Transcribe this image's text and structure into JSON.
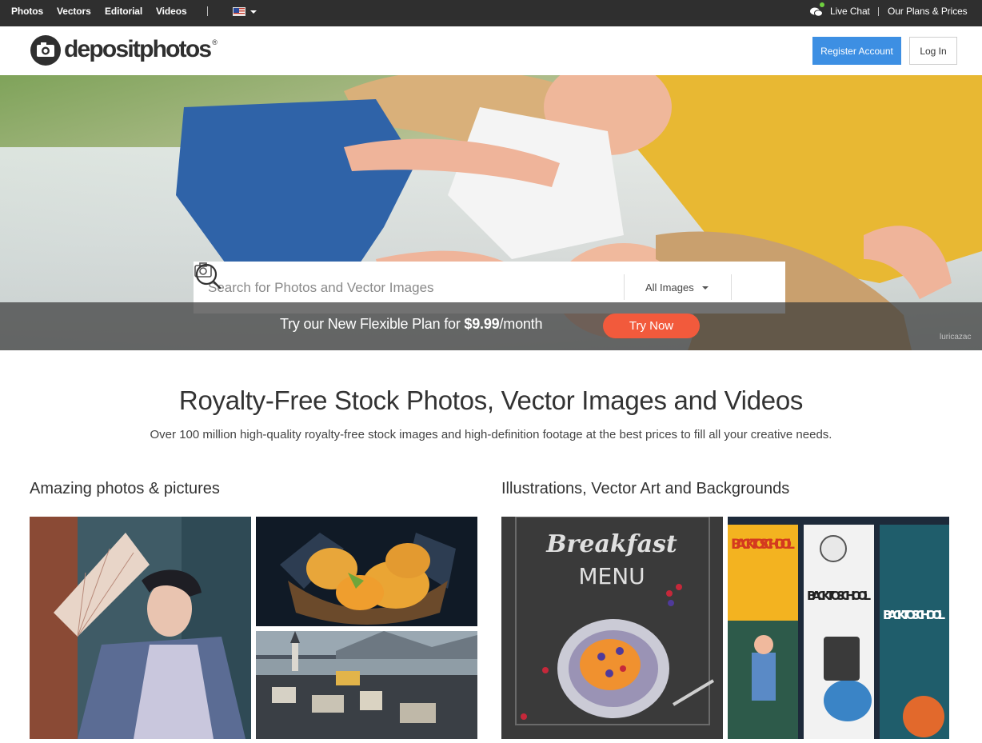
{
  "topbar": {
    "nav": [
      "Photos",
      "Vectors",
      "Editorial",
      "Videos"
    ],
    "live_chat": "Live Chat",
    "plans": "Our Plans & Prices"
  },
  "header": {
    "logo_text": "depositphotos",
    "logo_reg": "®",
    "register_label": "Register Account",
    "login_label": "Log In"
  },
  "hero": {
    "search_placeholder": "Search for Photos and Vector Images",
    "image_type": "All Images",
    "promo_prefix": "Try our New Flexible Plan for ",
    "promo_price": "$9.99",
    "promo_suffix": "/month",
    "cta_label": "Try Now",
    "photo_credit": "luricazac"
  },
  "intro": {
    "title": "Royalty-Free Stock Photos, Vector Images and Videos",
    "subtitle": "Over 100 million high-quality royalty-free stock images and high-definition footage at the best prices to fill all your creative needs."
  },
  "sections": {
    "photos_title": "Amazing photos & pictures",
    "vectors_title": "Illustrations, Vector Art and Backgrounds"
  },
  "tiles": {
    "breakfast_line1": "Breakfast",
    "breakfast_line2": "MENU",
    "back_to_school_1": "BACK TO SCHOOL",
    "back_to_school_2": "BACK TO SCHOOL",
    "back_to_school_3": "BACK TO SCHOOL"
  },
  "colors": {
    "topbar": "#2f2f2f",
    "register_blue": "#3d8fe3",
    "cta_orange": "#f25a3c"
  }
}
